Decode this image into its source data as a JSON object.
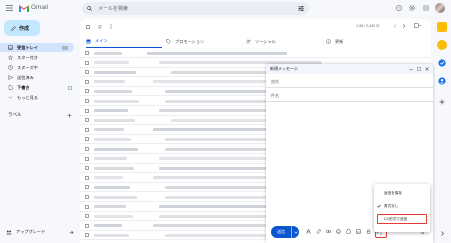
{
  "app": {
    "name": "Gmail"
  },
  "search": {
    "placeholder": "メールを検索"
  },
  "compose_button": {
    "label": "作成"
  },
  "sidebar": {
    "items": [
      {
        "label": "受信トレイ",
        "count": ""
      },
      {
        "label": "スター付き"
      },
      {
        "label": "スヌーズ中"
      },
      {
        "label": "送信済み"
      },
      {
        "label": "下書き"
      },
      {
        "label": "もっと見る"
      }
    ],
    "labels_heading": "ラベル"
  },
  "upgrade": {
    "label": "アップグレード"
  },
  "toolbar": {
    "pagination": "1-50 / 2,430 行"
  },
  "tabs": [
    {
      "label": "メイン"
    },
    {
      "label": "プロモーション"
    },
    {
      "label": "ソーシャル"
    },
    {
      "label": "更新"
    }
  ],
  "compose_window": {
    "title": "新規メッセージ",
    "to_label": "宛先",
    "subject_label": "件名",
    "send_label": "送信"
  },
  "context_menu": {
    "items": [
      {
        "label": "返信を保存"
      },
      {
        "label": "書式なし"
      },
      {
        "label": "CC形式で送信"
      }
    ]
  },
  "colors": {
    "accent": "#0b57d0",
    "compose_bg": "#c2e7ff",
    "highlight": "#e53935"
  },
  "icons": [
    "hamburger-icon",
    "gmail-logo",
    "search-icon",
    "filter-icon",
    "help-icon",
    "gear-icon",
    "apps-icon",
    "pencil-icon",
    "inbox-icon",
    "star-icon",
    "clock-icon",
    "send-icon",
    "draft-icon",
    "chevron-down-icon",
    "plus-icon",
    "tab-inbox-icon",
    "tag-icon",
    "people-icon",
    "info-icon",
    "minimize-icon",
    "expand-icon",
    "close-icon",
    "check-icon",
    "more-vert-icon",
    "attach-icon",
    "link-icon",
    "emoji-icon",
    "trash-icon"
  ]
}
